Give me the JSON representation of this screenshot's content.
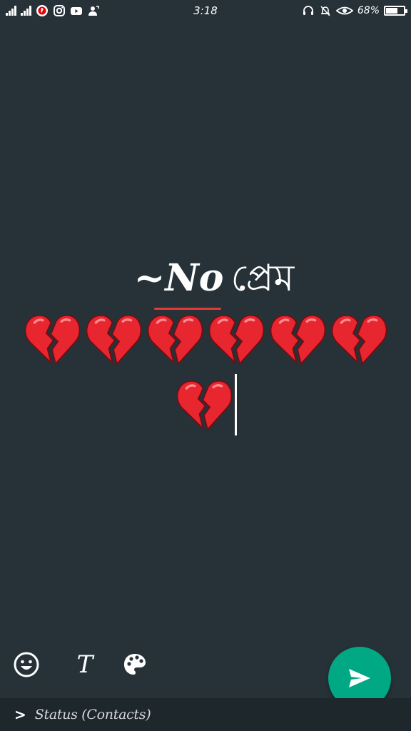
{
  "status_bar": {
    "time": "3:18",
    "battery_percent": "68%",
    "battery_level": 0.68,
    "left_icons": [
      "signal-icon",
      "signal-icon",
      "vodafone-icon",
      "instagram-icon",
      "youtube-icon",
      "contact-sync-icon"
    ],
    "right_icons": [
      "headset-icon",
      "mute-bell-icon",
      "eye-icon",
      "battery-icon"
    ]
  },
  "composer": {
    "title_prefix": "~No",
    "title_text": "প্রেম",
    "emoji_row_1": [
      "💔",
      "💔",
      "💔",
      "💔",
      "💔",
      "💔"
    ],
    "emoji_row_2": [
      "💔"
    ]
  },
  "tools": {
    "emoji_icon": "emoji-icon",
    "text_label": "T",
    "palette_icon": "palette-icon",
    "send_icon": "send-icon"
  },
  "bottom_bar": {
    "label": "Status (Contacts)"
  },
  "colors": {
    "background": "#263238",
    "accent": "#00a884",
    "underline": "#e53935",
    "heart": "#e8262f"
  }
}
